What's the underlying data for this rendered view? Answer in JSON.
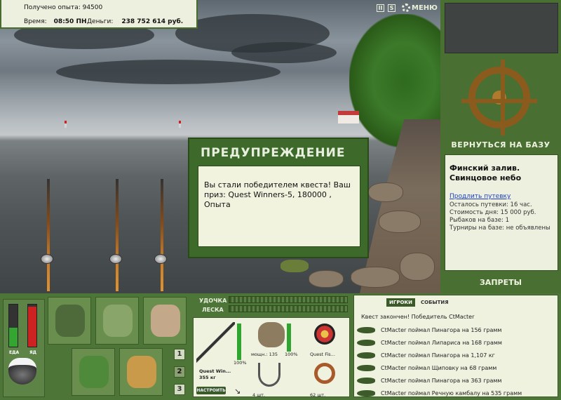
{
  "hud": {
    "exp_text": "Получено опыта: 94500",
    "time_label": "Время:",
    "time_value": "08:50 ПН",
    "money_label": "Деньги:",
    "money_value": "238 752 614 руб.",
    "btn_pause": "II",
    "btn_sound": "S",
    "menu_label": "МЕНЮ"
  },
  "dialog": {
    "title": "ПРЕДУПРЕЖДЕНИЕ",
    "message": "Вы стали победителем квеста! Ваш приз: Quest Winners-5, 180000 , Опыта"
  },
  "right_panel": {
    "back_label": "ВЕРНУТЬСЯ НА БАЗУ",
    "location_name": "Финский залив.",
    "location_sub": "Свинцовое небо",
    "extend_link": "Продлить путевку",
    "stats": [
      "Осталось путевки: 16 час.",
      "Стоимость дня: 15 000 руб.",
      "Рыбаков на базе: 1",
      "Турниры на базе: не объявлены"
    ],
    "bans_label": "ЗАПРЕТЫ"
  },
  "needs": {
    "food_label": "ЕДА",
    "poison_label": "ЯД",
    "food_level": 0.45,
    "poison_level": 0.95
  },
  "inventory": {
    "pages": [
      "1",
      "2",
      "3"
    ]
  },
  "rod": {
    "rod_label": "УДОЧКА",
    "line_label": "ЛЕСКА",
    "rod_name": "Quest Win...",
    "rod_weight": "355 кг",
    "rod_pct": "100%",
    "reel_power": "мощн.: 135",
    "reel_pct": "100%",
    "line_name": "Quest Fis...",
    "hook_count": "4 шт.",
    "bait_count": "62 шт.",
    "setup_label": "НАСТРОИТЬ"
  },
  "chat": {
    "tab_players": "ИГРОКИ",
    "tab_events": "СОБЫТИЯ",
    "header": "Квест закончен! Победитель CtMacter",
    "events": [
      "CtMacter поймал Пинагора на 156 грамм",
      "CtMacter поймал Липариса на 168 грамм",
      "CtMacter поймал Пинагора на 1,107 кг",
      "CtMacter поймал Щиповку на 68 грамм",
      "CtMacter поймал Пинагора на 363 грамм",
      "CtMacter поймал Речную камбалу на 535 грамм"
    ]
  }
}
